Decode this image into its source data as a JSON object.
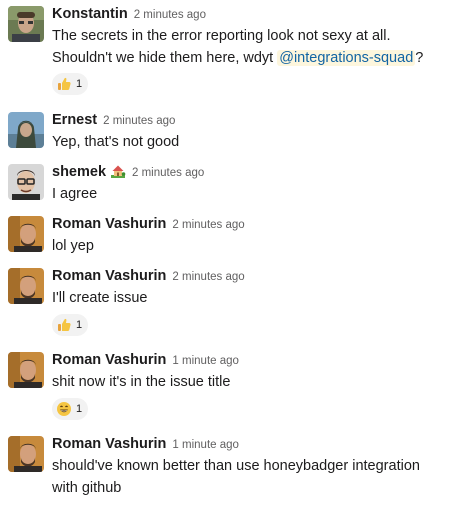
{
  "messages": [
    {
      "author": "Konstantin",
      "time": "2 minutes ago",
      "line1": "The secrets in the error reporting look not sexy at all.",
      "line2_before": "Shouldn't we hide them here, wdyt ",
      "mention": "@integrations-squad",
      "line2_after": "?",
      "reaction": {
        "emoji": "thumbs-up-icon",
        "count": "1"
      }
    },
    {
      "author": "Ernest",
      "time": "2 minutes ago",
      "text": "Yep, that's not good"
    },
    {
      "author": "shemek",
      "time": "2 minutes ago",
      "status_icon": "house-with-garden-icon",
      "text": "I agree"
    },
    {
      "author": "Roman Vashurin",
      "time": "2 minutes ago",
      "text": "lol yep"
    },
    {
      "author": "Roman Vashurin",
      "time": "2 minutes ago",
      "text": "I'll create issue",
      "reaction": {
        "emoji": "thumbs-up-icon",
        "count": "1"
      }
    },
    {
      "author": "Roman Vashurin",
      "time": "1 minute ago",
      "text": "shit now it's in the issue title",
      "reaction": {
        "emoji": "grinning-face-icon",
        "count": "1"
      }
    },
    {
      "author": "Roman Vashurin",
      "time": "1 minute ago",
      "line1": "should've known better than use honeybadger integration",
      "line2": "with github"
    }
  ],
  "colors": {
    "mention_text": "#1264a3",
    "mention_bg": "#fdf6dd",
    "timestamp": "#616061",
    "reaction_bg": "#f2f2f2"
  }
}
